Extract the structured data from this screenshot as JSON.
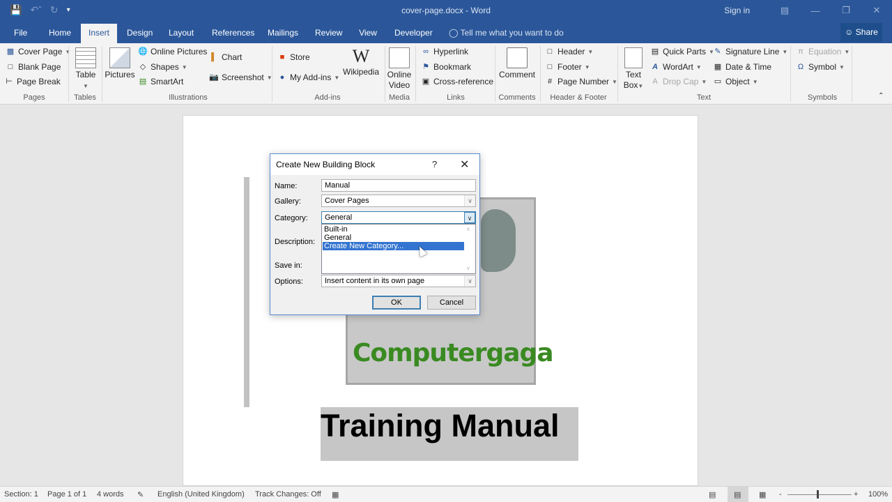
{
  "titlebar": {
    "doc_title": "cover-page.docx - Word",
    "sign_in": "Sign in",
    "qat": {
      "save": "save-icon",
      "undo": "undo-icon",
      "redo": "redo-icon",
      "customize": "customize-qat-icon"
    },
    "window_controls": [
      "ribbon-display-options",
      "minimize",
      "restore",
      "close"
    ]
  },
  "tabs": [
    {
      "label": "File"
    },
    {
      "label": "Home"
    },
    {
      "label": "Insert",
      "active": true
    },
    {
      "label": "Design"
    },
    {
      "label": "Layout"
    },
    {
      "label": "References"
    },
    {
      "label": "Mailings"
    },
    {
      "label": "Review"
    },
    {
      "label": "View"
    },
    {
      "label": "Developer"
    }
  ],
  "tell_me": "Tell me what you want to do",
  "share": "Share",
  "ribbon": {
    "pages": {
      "label": "Pages",
      "cover_page": "Cover Page",
      "blank_page": "Blank Page",
      "page_break": "Page Break"
    },
    "tables": {
      "label": "Tables",
      "table": "Table"
    },
    "illustrations": {
      "label": "Illustrations",
      "pictures": "Pictures",
      "online_pictures": "Online Pictures",
      "shapes": "Shapes",
      "smartart": "SmartArt",
      "chart": "Chart",
      "screenshot": "Screenshot"
    },
    "addins": {
      "label": "Add-ins",
      "store": "Store",
      "my_addins": "My Add-ins",
      "wikipedia": "Wikipedia"
    },
    "media": {
      "label": "Media",
      "online_video_1": "Online",
      "online_video_2": "Video"
    },
    "links": {
      "label": "Links",
      "hyperlink": "Hyperlink",
      "bookmark": "Bookmark",
      "cross_reference": "Cross-reference"
    },
    "comments": {
      "label": "Comments",
      "comment": "Comment"
    },
    "header_footer": {
      "label": "Header & Footer",
      "header": "Header",
      "footer": "Footer",
      "page_number": "Page Number"
    },
    "text": {
      "label": "Text",
      "text_box_1": "Text",
      "text_box_2": "Box",
      "quick_parts": "Quick Parts",
      "wordart": "WordArt",
      "drop_cap": "Drop Cap",
      "signature_line": "Signature Line",
      "date_time": "Date & Time",
      "object": "Object"
    },
    "symbols": {
      "label": "Symbols",
      "equation": "Equation",
      "symbol": "Symbol"
    }
  },
  "document": {
    "brand_text": "Computergaga",
    "heading": "Training Manual"
  },
  "dialog": {
    "title": "Create New Building Block",
    "help": "?",
    "fields": {
      "name_label": "Name:",
      "name_value": "Manual",
      "gallery_label": "Gallery:",
      "gallery_value": "Cover Pages",
      "category_label": "Category:",
      "category_value": "General",
      "description_label": "Description:",
      "save_in_label": "Save in:",
      "options_label": "Options:",
      "options_value": "Insert content in its own page"
    },
    "category_options": [
      "Built-in",
      "General",
      "Create New Category..."
    ],
    "category_highlighted": "Create New Category...",
    "ok": "OK",
    "cancel": "Cancel"
  },
  "statusbar": {
    "section": "Section: 1",
    "page": "Page 1 of 1",
    "words": "4 words",
    "language": "English (United Kingdom)",
    "track_changes": "Track Changes: Off",
    "zoom_minus": "-",
    "zoom_plus": "+",
    "zoom_level": "100%"
  },
  "colors": {
    "accent": "#2b579a",
    "selection": "#3374d0",
    "brand_green": "#3a8a22"
  }
}
